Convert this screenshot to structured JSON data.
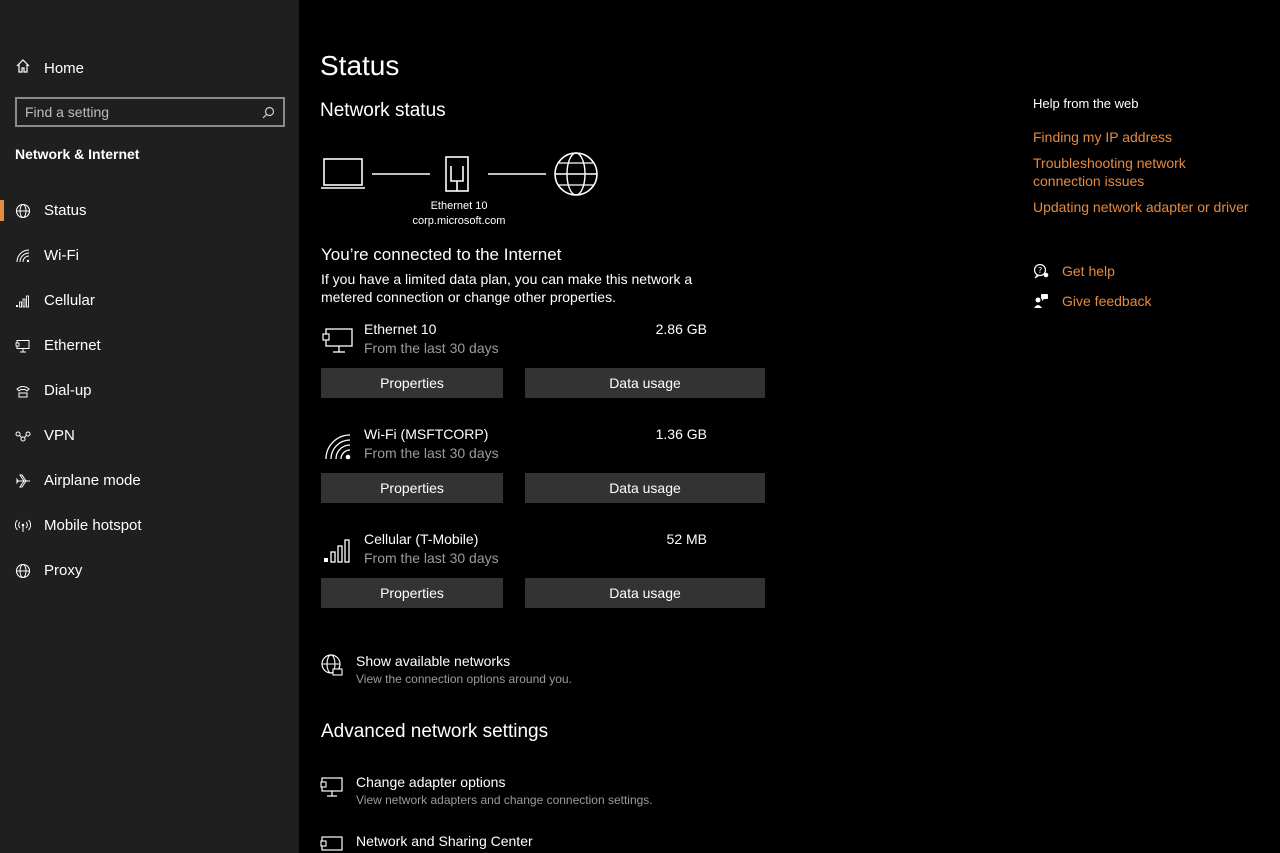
{
  "sidebar": {
    "home_label": "Home",
    "search_placeholder": "Find a setting",
    "section_title": "Network & Internet",
    "items": [
      {
        "label": "Status",
        "icon": "globe-status-icon",
        "selected": true
      },
      {
        "label": "Wi-Fi",
        "icon": "wifi-icon"
      },
      {
        "label": "Cellular",
        "icon": "cellular-icon"
      },
      {
        "label": "Ethernet",
        "icon": "ethernet-icon"
      },
      {
        "label": "Dial-up",
        "icon": "dialup-icon"
      },
      {
        "label": "VPN",
        "icon": "vpn-icon"
      },
      {
        "label": "Airplane mode",
        "icon": "airplane-icon"
      },
      {
        "label": "Mobile hotspot",
        "icon": "hotspot-icon"
      },
      {
        "label": "Proxy",
        "icon": "globe-icon"
      }
    ],
    "accent_color": "#e68a3e"
  },
  "main": {
    "title": "Status",
    "network_status_heading": "Network status",
    "diagram": {
      "adapter_name": "Ethernet 10",
      "domain": "corp.microsoft.com"
    },
    "connected_title": "You’re connected to the Internet",
    "connected_desc": "If you have a limited data plan, you can make this network a metered connection or change other properties.",
    "networks": [
      {
        "name": "Ethernet 10",
        "sub": "From the last 30 days",
        "size": "2.86 GB",
        "icon": "ethernet-monitor-icon",
        "properties_label": "Properties",
        "data_usage_label": "Data usage"
      },
      {
        "name": "Wi-Fi (MSFTCORP)",
        "sub": "From the last 30 days",
        "size": "1.36 GB",
        "icon": "wifi-icon",
        "properties_label": "Properties",
        "data_usage_label": "Data usage"
      },
      {
        "name": "Cellular (T-Mobile)",
        "sub": "From the last 30 days",
        "size": "52 MB",
        "icon": "cellular-bars-icon",
        "properties_label": "Properties",
        "data_usage_label": "Data usage"
      }
    ],
    "show_networks": {
      "title": "Show available networks",
      "desc": "View the connection options around you."
    },
    "advanced_heading": "Advanced network settings",
    "change_adapter": {
      "title": "Change adapter options",
      "desc": "View network adapters and change connection settings."
    },
    "sharing_center": {
      "title": "Network and Sharing Center"
    }
  },
  "right": {
    "help_title": "Help from the web",
    "links": [
      "Finding my IP address",
      "Troubleshooting network connection issues",
      "Updating network adapter or driver"
    ],
    "get_help": "Get help",
    "give_feedback": "Give feedback"
  }
}
